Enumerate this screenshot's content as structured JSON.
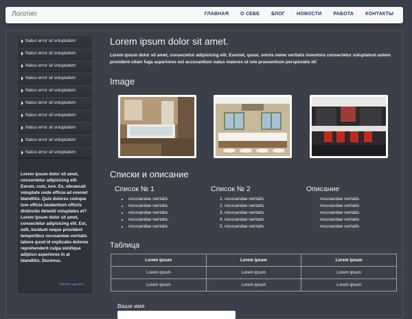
{
  "header": {
    "logo": "Логотип",
    "nav": [
      "ГЛАВНАЯ",
      "О СЕБЕ",
      "БЛОГ",
      "НОВОСТИ",
      "РАБОТА",
      "КОНТАКТЫ"
    ]
  },
  "sidebar": {
    "items": [
      "Natus error sit voluptatem",
      "Natus error sit voluptatem",
      "Natus error sit voluptatem",
      "Natus error sit voluptatem",
      "Natus error sit voluptatem",
      "Natus error sit voluptatem",
      "Natus error sit voluptatem",
      "Natus error sit voluptatem",
      "Natus error sit voluptatem",
      "Natus error sit voluptatem"
    ],
    "box_text": "Lorem ipsum dolor sit amet, consectetur adipisicing elit. Earum, cum, iure. Ex, obcaecati voluptate unde officia ad eveniet blanditiis. Quis dolores cumque iure officia laudantium officiis distinctio deleniti voluptates et? Lorem ipsum dolor sit amet, consectetur adipisicing elit. Est, odit, incidunt neque provident temporibus recusandae veritatis labore quod id explicabo dolores reprehenderit culpa similique adipisci asperiores in at blanditiis. Ducimus.",
    "read_more": "Читать далее..."
  },
  "main": {
    "title": "Lorem ipsum dolor sit amet.",
    "lead": "Lorem ipsum dolor sit amet, consectetur adipisicing elit. Eveniet, quasi, omnis neme veritatis inventore consectetur voluptatum autem provident ullam fuga asperiores est accusantium natus maiores ut iste praesentium perspiciatis id!",
    "images_title": "Image",
    "lists_title": "Списки и описание",
    "list1": {
      "title": "Список № 1",
      "items": [
        "recusandae veritatis",
        "recusandae veritatis",
        "recusandae veritatis",
        "recusandae veritatis",
        "recusandae veritatis"
      ]
    },
    "list2": {
      "title": "Список № 2",
      "items": [
        "recusandae veritatis",
        "recusandae veritatis",
        "recusandae veritatis",
        "recusandae veritatis",
        "recusandae veritatis"
      ]
    },
    "list3": {
      "title": "Описание",
      "items": [
        "recusandae veritatis",
        "recusandae veritatis",
        "recusandae veritatis",
        "recusandae veritatis",
        "recusandae veritatis"
      ]
    },
    "table_title": "Таблица",
    "table": {
      "header": [
        "Lorem ipsum",
        "Lorem ipsum",
        "Lorem ipsum"
      ],
      "rows": [
        [
          "Lorem ipsum",
          "Lorem ipsum",
          "Lorem ipsum"
        ],
        [
          "Lorem ipsum",
          "Lorem ipsum",
          "Lorem ipsum"
        ]
      ]
    },
    "form_label": "Ваше имя"
  }
}
